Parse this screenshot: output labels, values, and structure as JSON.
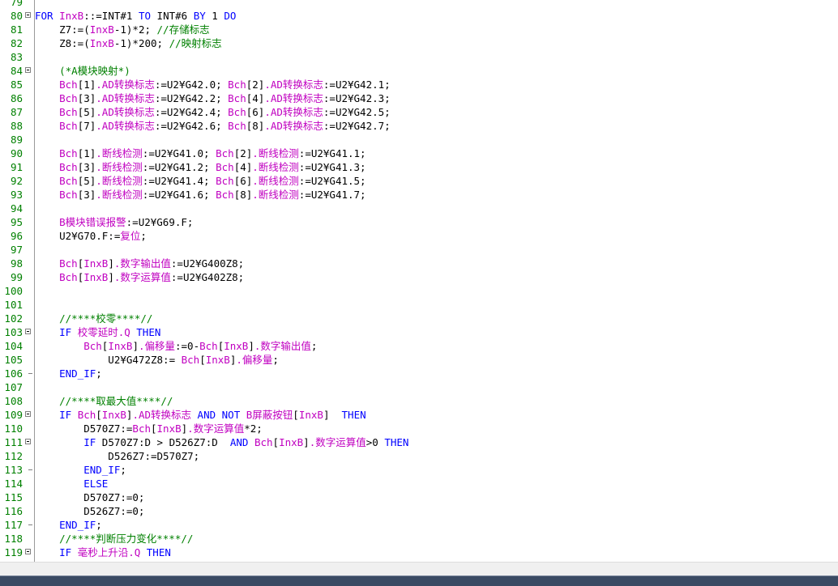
{
  "editor": {
    "lines": [
      {
        "n": "79",
        "fold": "",
        "tokens": []
      },
      {
        "n": "80",
        "fold": "open",
        "tokens": [
          [
            "kw",
            "FOR "
          ],
          [
            "var",
            "InxB"
          ],
          [
            "",
            "::=INT#1 "
          ],
          [
            "kw",
            "TO"
          ],
          [
            "",
            " INT#6 "
          ],
          [
            "kw",
            "BY"
          ],
          [
            "",
            " 1 "
          ],
          [
            "kw",
            "DO"
          ]
        ]
      },
      {
        "n": "81",
        "fold": "",
        "tokens": [
          [
            "",
            "    Z7:=("
          ],
          [
            "var",
            "InxB"
          ],
          [
            "",
            "-1)*2; "
          ],
          [
            "cm",
            "//存储标志"
          ]
        ]
      },
      {
        "n": "82",
        "fold": "",
        "tokens": [
          [
            "",
            "    Z8:=("
          ],
          [
            "var",
            "InxB"
          ],
          [
            "",
            "-1)*200; "
          ],
          [
            "cm",
            "//映射标志"
          ]
        ]
      },
      {
        "n": "83",
        "fold": "",
        "tokens": []
      },
      {
        "n": "84",
        "fold": "open",
        "tokens": [
          [
            "cm",
            "    (*A模块映射*)"
          ]
        ]
      },
      {
        "n": "85",
        "fold": "",
        "tokens": [
          [
            "var",
            "    Bch"
          ],
          [
            "",
            "[1]"
          ],
          [
            "var",
            ".AD转换标志"
          ],
          [
            "",
            ":=U2¥G42.0; "
          ],
          [
            "var",
            "Bch"
          ],
          [
            "",
            "[2]"
          ],
          [
            "var",
            ".AD转换标志"
          ],
          [
            "",
            ":=U2¥G42.1;"
          ]
        ]
      },
      {
        "n": "86",
        "fold": "",
        "tokens": [
          [
            "var",
            "    Bch"
          ],
          [
            "",
            "[3]"
          ],
          [
            "var",
            ".AD转换标志"
          ],
          [
            "",
            ":=U2¥G42.2; "
          ],
          [
            "var",
            "Bch"
          ],
          [
            "",
            "[4]"
          ],
          [
            "var",
            ".AD转换标志"
          ],
          [
            "",
            ":=U2¥G42.3;"
          ]
        ]
      },
      {
        "n": "87",
        "fold": "",
        "tokens": [
          [
            "var",
            "    Bch"
          ],
          [
            "",
            "[5]"
          ],
          [
            "var",
            ".AD转换标志"
          ],
          [
            "",
            ":=U2¥G42.4; "
          ],
          [
            "var",
            "Bch"
          ],
          [
            "",
            "[6]"
          ],
          [
            "var",
            ".AD转换标志"
          ],
          [
            "",
            ":=U2¥G42.5;"
          ]
        ]
      },
      {
        "n": "88",
        "fold": "",
        "tokens": [
          [
            "var",
            "    Bch"
          ],
          [
            "",
            "[7]"
          ],
          [
            "var",
            ".AD转换标志"
          ],
          [
            "",
            ":=U2¥G42.6; "
          ],
          [
            "var",
            "Bch"
          ],
          [
            "",
            "[8]"
          ],
          [
            "var",
            ".AD转换标志"
          ],
          [
            "",
            ":=U2¥G42.7;"
          ]
        ]
      },
      {
        "n": "89",
        "fold": "",
        "tokens": []
      },
      {
        "n": "90",
        "fold": "",
        "tokens": [
          [
            "var",
            "    Bch"
          ],
          [
            "",
            "[1]"
          ],
          [
            "var",
            ".断线检测"
          ],
          [
            "",
            ":=U2¥G41.0; "
          ],
          [
            "var",
            "Bch"
          ],
          [
            "",
            "[2]"
          ],
          [
            "var",
            ".断线检测"
          ],
          [
            "",
            ":=U2¥G41.1;"
          ]
        ]
      },
      {
        "n": "91",
        "fold": "",
        "tokens": [
          [
            "var",
            "    Bch"
          ],
          [
            "",
            "[3]"
          ],
          [
            "var",
            ".断线检测"
          ],
          [
            "",
            ":=U2¥G41.2; "
          ],
          [
            "var",
            "Bch"
          ],
          [
            "",
            "[4]"
          ],
          [
            "var",
            ".断线检测"
          ],
          [
            "",
            ":=U2¥G41.3;"
          ]
        ]
      },
      {
        "n": "92",
        "fold": "",
        "tokens": [
          [
            "var",
            "    Bch"
          ],
          [
            "",
            "[5]"
          ],
          [
            "var",
            ".断线检测"
          ],
          [
            "",
            ":=U2¥G41.4; "
          ],
          [
            "var",
            "Bch"
          ],
          [
            "",
            "[6]"
          ],
          [
            "var",
            ".断线检测"
          ],
          [
            "",
            ":=U2¥G41.5;"
          ]
        ]
      },
      {
        "n": "93",
        "fold": "",
        "tokens": [
          [
            "var",
            "    Bch"
          ],
          [
            "",
            "[3]"
          ],
          [
            "var",
            ".断线检测"
          ],
          [
            "",
            ":=U2¥G41.6; "
          ],
          [
            "var",
            "Bch"
          ],
          [
            "",
            "[8]"
          ],
          [
            "var",
            ".断线检测"
          ],
          [
            "",
            ":=U2¥G41.7;"
          ]
        ]
      },
      {
        "n": "94",
        "fold": "",
        "tokens": []
      },
      {
        "n": "95",
        "fold": "",
        "tokens": [
          [
            "var",
            "    B模块错误报警"
          ],
          [
            "",
            ":=U2¥G69.F;"
          ]
        ]
      },
      {
        "n": "96",
        "fold": "",
        "tokens": [
          [
            "",
            "    U2¥G70.F:="
          ],
          [
            "var",
            "复位"
          ],
          [
            "",
            ";"
          ]
        ]
      },
      {
        "n": "97",
        "fold": "",
        "tokens": []
      },
      {
        "n": "98",
        "fold": "",
        "tokens": [
          [
            "var",
            "    Bch"
          ],
          [
            "",
            "["
          ],
          [
            "var",
            "InxB"
          ],
          [
            "",
            "]"
          ],
          [
            "var",
            ".数字输出值"
          ],
          [
            "",
            ":=U2¥G400Z8;"
          ]
        ]
      },
      {
        "n": "99",
        "fold": "",
        "tokens": [
          [
            "var",
            "    Bch"
          ],
          [
            "",
            "["
          ],
          [
            "var",
            "InxB"
          ],
          [
            "",
            "]"
          ],
          [
            "var",
            ".数字运算值"
          ],
          [
            "",
            ":=U2¥G402Z8;"
          ]
        ]
      },
      {
        "n": "100",
        "fold": "",
        "tokens": []
      },
      {
        "n": "101",
        "fold": "",
        "tokens": []
      },
      {
        "n": "102",
        "fold": "",
        "tokens": [
          [
            "cm",
            "    //****校零****//"
          ]
        ]
      },
      {
        "n": "103",
        "fold": "open",
        "tokens": [
          [
            "kw",
            "    IF "
          ],
          [
            "var",
            "校零延时.Q"
          ],
          [
            "kw",
            " THEN"
          ]
        ]
      },
      {
        "n": "104",
        "fold": "",
        "tokens": [
          [
            "var",
            "        Bch"
          ],
          [
            "",
            "["
          ],
          [
            "var",
            "InxB"
          ],
          [
            "",
            "]"
          ],
          [
            "var",
            ".偏移量"
          ],
          [
            "",
            ":=0-"
          ],
          [
            "var",
            "Bch"
          ],
          [
            "",
            "["
          ],
          [
            "var",
            "InxB"
          ],
          [
            "",
            "]"
          ],
          [
            "var",
            ".数字输出值"
          ],
          [
            "",
            ";"
          ]
        ]
      },
      {
        "n": "105",
        "fold": "",
        "tokens": [
          [
            "",
            "            U2¥G472Z8:= "
          ],
          [
            "var",
            "Bch"
          ],
          [
            "",
            "["
          ],
          [
            "var",
            "InxB"
          ],
          [
            "",
            "]"
          ],
          [
            "var",
            ".偏移量"
          ],
          [
            "",
            ";"
          ]
        ]
      },
      {
        "n": "106",
        "fold": "end",
        "tokens": [
          [
            "kw",
            "    END_IF"
          ],
          [
            "",
            ";"
          ]
        ]
      },
      {
        "n": "107",
        "fold": "",
        "tokens": []
      },
      {
        "n": "108",
        "fold": "",
        "tokens": [
          [
            "cm",
            "    //****取最大值****//"
          ]
        ]
      },
      {
        "n": "109",
        "fold": "open",
        "tokens": [
          [
            "kw",
            "    IF "
          ],
          [
            "var",
            "Bch"
          ],
          [
            "",
            "["
          ],
          [
            "var",
            "InxB"
          ],
          [
            "",
            "]"
          ],
          [
            "var",
            ".AD转换标志"
          ],
          [
            "",
            " "
          ],
          [
            "kw",
            "AND"
          ],
          [
            "",
            " "
          ],
          [
            "kw",
            "NOT"
          ],
          [
            "",
            " "
          ],
          [
            "var",
            "B屏蔽按钮"
          ],
          [
            "",
            "["
          ],
          [
            "var",
            "InxB"
          ],
          [
            "",
            "]  "
          ],
          [
            "kw",
            "THEN"
          ]
        ]
      },
      {
        "n": "110",
        "fold": "",
        "tokens": [
          [
            "",
            "        D570Z7:="
          ],
          [
            "var",
            "Bch"
          ],
          [
            "",
            "["
          ],
          [
            "var",
            "InxB"
          ],
          [
            "",
            "]"
          ],
          [
            "var",
            ".数字运算值"
          ],
          [
            "",
            "*2;"
          ]
        ]
      },
      {
        "n": "111",
        "fold": "open",
        "tokens": [
          [
            "kw",
            "        IF "
          ],
          [
            "",
            "D570Z7:D > D526Z7:D  "
          ],
          [
            "kw",
            "AND"
          ],
          [
            "",
            " "
          ],
          [
            "var",
            "Bch"
          ],
          [
            "",
            "["
          ],
          [
            "var",
            "InxB"
          ],
          [
            "",
            "]"
          ],
          [
            "var",
            ".数字运算值"
          ],
          [
            "",
            ">0 "
          ],
          [
            "kw",
            "THEN"
          ]
        ]
      },
      {
        "n": "112",
        "fold": "",
        "tokens": [
          [
            "",
            "            D526Z7:=D570Z7;"
          ]
        ]
      },
      {
        "n": "113",
        "fold": "end",
        "tokens": [
          [
            "kw",
            "        END_IF"
          ],
          [
            "",
            ";"
          ]
        ]
      },
      {
        "n": "114",
        "fold": "",
        "tokens": [
          [
            "kw",
            "        ELSE"
          ]
        ]
      },
      {
        "n": "115",
        "fold": "",
        "tokens": [
          [
            "",
            "        D570Z7:=0;"
          ]
        ]
      },
      {
        "n": "116",
        "fold": "",
        "tokens": [
          [
            "",
            "        D526Z7:=0;"
          ]
        ]
      },
      {
        "n": "117",
        "fold": "end",
        "tokens": [
          [
            "kw",
            "    END_IF"
          ],
          [
            "",
            ";"
          ]
        ]
      },
      {
        "n": "118",
        "fold": "",
        "tokens": [
          [
            "cm",
            "    //****判断压力变化****//"
          ]
        ]
      },
      {
        "n": "119",
        "fold": "open",
        "tokens": [
          [
            "kw",
            "    IF "
          ],
          [
            "var",
            "毫秒上升沿.Q"
          ],
          [
            "kw",
            " THEN"
          ]
        ]
      }
    ]
  },
  "colors": {
    "keyword": "#0000ff",
    "variable": "#c000c0",
    "comment": "#008000",
    "line_number": "#008000",
    "text": "#000000"
  }
}
